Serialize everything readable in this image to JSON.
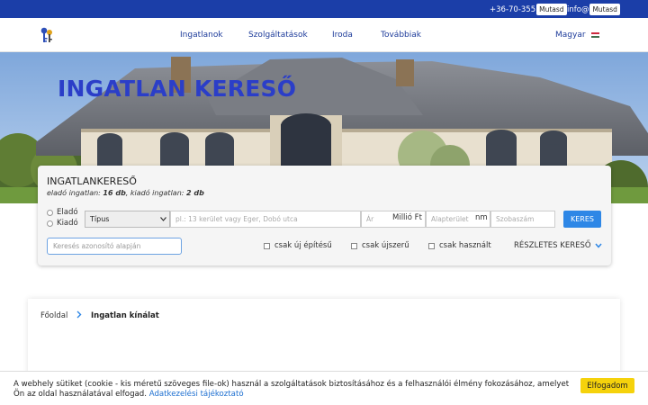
{
  "topbar": {
    "phone": "+36-70-355",
    "phone_reveal": "Mutasd",
    "email": "info@",
    "email_reveal": "Mutasd"
  },
  "nav": {
    "items": [
      "Ingatlanok",
      "Szolgáltatások",
      "Iroda",
      "Továbbiak"
    ],
    "language": "Magyar"
  },
  "hero": {
    "title": "INGATLAN KERESŐ"
  },
  "search": {
    "title": "INGATLANKERESŐ",
    "counts_prefix": "eladó ingatlan:",
    "sale_count": "16 db",
    "counts_mid": ", kiadó ingatlan:",
    "rent_count": "2 db",
    "option_sale": "Eladó",
    "option_rent": "Kiadó",
    "type_select": "Típus",
    "location_placeholder": "pl.: 13 kerület vagy Eger, Dobó utca",
    "price_placeholder": "Ár",
    "price_unit": "Millió Ft",
    "area_placeholder": "Alapterület",
    "area_unit": "nm",
    "rooms_placeholder": "Szobaszám",
    "search_button": "KERES",
    "id_placeholder": "Keresés azonosító alapján",
    "check_new": "csak új építésű",
    "check_like_new": "csak újszerű",
    "check_used": "csak használt",
    "detailed_search": "RÉSZLETES KERESŐ"
  },
  "breadcrumb": {
    "home": "Főoldal",
    "current": "Ingatlan kínálat"
  },
  "cookie": {
    "text": "A webhely sütiket (cookie - kis méretű szöveges file-ok) használ a szolgáltatások biztosításához és a felhasználói élmény fokozásához, amelyet Ön az oldal használatával elfogad.",
    "link": "Adatkezelési tájékoztató",
    "accept": "Elfogadom"
  },
  "colors": {
    "topbar": "#1b3ea8",
    "accent": "#2e87e6",
    "hero_title": "#2b3ec8",
    "cookie_button": "#f5d20c"
  }
}
